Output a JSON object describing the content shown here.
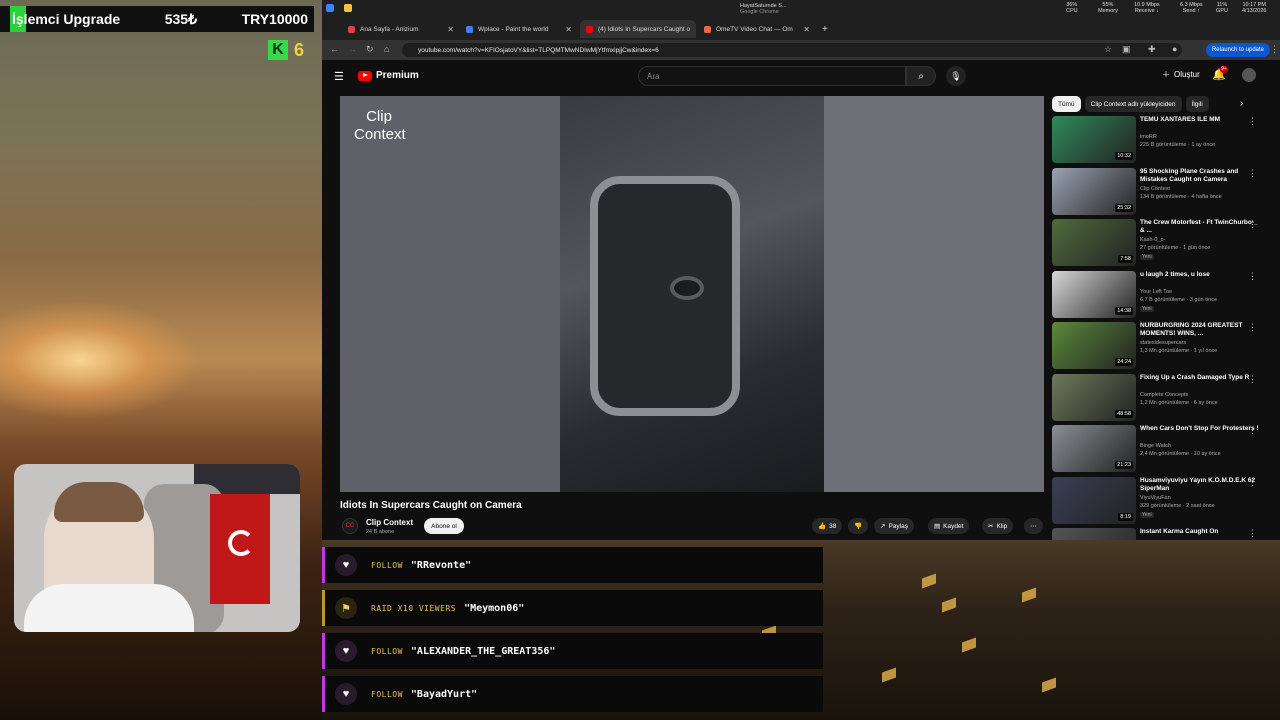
{
  "overlay": {
    "label": "İşlemci Upgrade",
    "amount": "535₺",
    "goal": "TRY10000",
    "kick_letter": "K",
    "kick_count": "6"
  },
  "browser": {
    "tabs": [
      {
        "title": "Ana Sayfa - Anizium",
        "color": "#e04040"
      },
      {
        "title": "Wplace - Paint the world",
        "color": "#3b82f6"
      },
      {
        "title": "(4) Idiots In Supercars Caught o",
        "color": "#ff0000"
      },
      {
        "title": "OmeTV Video Chat — Om",
        "color": "#e64"
      }
    ],
    "url": "youtube.com/watch?v=KFIOsjatoVY&list=TLPQMTMwNDIwMjYtfmxipjjCw&index=6",
    "relaunch_label": "Relaunch to update",
    "system": {
      "cpu": "36%",
      "cpu_label": "CPU",
      "mem": "55%",
      "mem_label": "Memory",
      "net_down": "10.9 Mbps",
      "net_down_label": "Receive ↓",
      "net_up": "6.3 Mbps",
      "net_up_label": "Send ↑",
      "gpu": "11%",
      "gpu_label": "GPU",
      "time": "10:17 PM",
      "date": "4/13/2026",
      "notification_title": "HayatSaturnde S...",
      "notification_sub": "Google Chrome"
    }
  },
  "youtube": {
    "logo": "Premium",
    "search_placeholder": "Ara",
    "create_label": "Oluştur",
    "notif_count": "9+",
    "video_overlay_text": "Clip Context",
    "video_title": "Idiots In Supercars Caught on Camera",
    "channel": {
      "name": "Clip Context",
      "subs": "24 B abone",
      "avatar_text": "CC"
    },
    "subscribe_label": "Abone ol",
    "likes": "38",
    "share_label": "Paylaş",
    "save_label": "Kaydet",
    "clip_label": "Klip",
    "chips": [
      "Tümü",
      "Clip Context adlı yükleyiciden",
      "İlgili"
    ],
    "recommendations": [
      {
        "title": "TEMU XANTARES İLE MM",
        "channel": "imoRR",
        "meta": "225 B görüntüleme · 1 ay önce",
        "duration": "10:32",
        "badge": "",
        "color": "#2f8a5a"
      },
      {
        "title": "95 Shocking Plane Crashes and Mistakes Caught on Camera",
        "channel": "Clip Context",
        "meta": "134 B görüntüleme · 4 hafta önce",
        "duration": "25:32",
        "badge": "",
        "color": "#9aa4b4"
      },
      {
        "title": "The Crew Motorfest - Ft TwinChurbo-_ & ...",
        "channel": "Kash-0_o-",
        "meta": "27 görüntüleme · 1 gün önce",
        "duration": "7:58",
        "badge": "Yeni",
        "color": "#4f6b3e"
      },
      {
        "title": "u laugh 2 times, u lose",
        "channel": "Your Left Toe",
        "meta": "6,7 B görüntüleme · 3 gün önce",
        "duration": "14:38",
        "badge": "Yeni",
        "color": "#d8d8d8"
      },
      {
        "title": "NÜRBURGRING 2024 GREATEST MOMENTS! WINS, ...",
        "channel": "statesidesupercars",
        "meta": "1,3 Mn görüntüleme · 1 yıl önce",
        "duration": "24:24",
        "badge": "",
        "color": "#5a8a3a"
      },
      {
        "title": "Fixing Up a Crash Damaged Type R",
        "channel": "Complete Concepts",
        "meta": "1,2 Mn görüntüleme · 6 ay önce",
        "duration": "48:58",
        "badge": "",
        "color": "#6e7a5a"
      },
      {
        "title": "When Cars Don't Stop For Protesters !",
        "channel": "Binge Watch",
        "meta": "2,4 Mn görüntüleme · 10 ay önce",
        "duration": "21:23",
        "badge": "",
        "color": "#8a8f95"
      },
      {
        "title": "Husamviyuviyu Yayın K.Ö.M.D.E.K 62 SiperMan",
        "channel": "ViyuViyuFan",
        "meta": "329 görüntüleme · 2 saat önce",
        "duration": "8:19",
        "badge": "Yeni",
        "color": "#3a3f55"
      },
      {
        "title": "Instant Karma Caught On",
        "channel": "",
        "meta": "",
        "duration": "",
        "badge": "",
        "color": "#555"
      }
    ]
  },
  "alerts": [
    {
      "kind": "FOLLOW",
      "name": "\"RRevonte\"",
      "type": "follow"
    },
    {
      "kind": "RAID X10 VIEWERS",
      "name": "\"Meymon06\"",
      "type": "raid"
    },
    {
      "kind": "FOLLOW",
      "name": "\"ALEXANDER_THE_GREAT356\"",
      "type": "follow"
    },
    {
      "kind": "FOLLOW",
      "name": "\"BayadYurt\"",
      "type": "follow"
    }
  ],
  "colors": {
    "accent_green": "#2bd13a",
    "youtube_red": "#ff0000",
    "alert_purple": "#c13ae0",
    "alert_gold": "#e8c34a"
  }
}
